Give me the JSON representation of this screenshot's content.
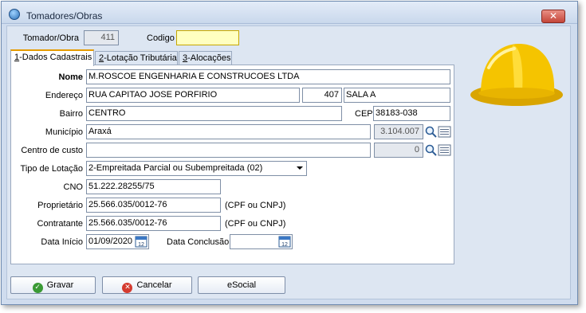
{
  "window": {
    "title": "Tomadores/Obras",
    "close_label": "✕"
  },
  "header": {
    "tomador_label": "Tomador/Obra",
    "tomador_value": "411",
    "codigo_label": "Codigo",
    "codigo_value": ""
  },
  "tabs": [
    {
      "key": "1",
      "label": "-Dados Cadastrais",
      "active": true
    },
    {
      "key": "2",
      "label": "-Lotação Tributária",
      "active": false
    },
    {
      "key": "3",
      "label": "-Alocações",
      "active": false
    }
  ],
  "form": {
    "nome_label": "Nome",
    "nome_value": "M.ROSCOE ENGENHARIA E CONSTRUCOES LTDA",
    "endereco_label": "Endereço",
    "endereco_value": "RUA CAPITAO JOSE PORFIRIO",
    "numero_value": "407",
    "complemento_value": "SALA A",
    "bairro_label": "Bairro",
    "bairro_value": "CENTRO",
    "cep_label": "CEP",
    "cep_value": "38183-038",
    "municipio_label": "Município",
    "municipio_value": "Araxá",
    "municipio_code": "3.104.007",
    "centro_custo_label": "Centro de custo",
    "centro_custo_value": "",
    "centro_custo_code": "0",
    "tipo_lotacao_label": "Tipo de Lotação",
    "tipo_lotacao_value": "2-Empreitada Parcial ou Subempreitada (02)",
    "cno_label": "CNO",
    "cno_value": "51.222.28255/75",
    "proprietario_label": "Proprietário",
    "proprietario_value": "25.566.035/0012-76",
    "proprietario_hint": "(CPF ou CNPJ)",
    "contratante_label": "Contratante",
    "contratante_value": "25.566.035/0012-76",
    "contratante_hint": "(CPF ou CNPJ)",
    "data_inicio_label": "Data Início",
    "data_inicio_value": "01/09/2020",
    "data_conclusao_label": "Data Conclusão",
    "data_conclusao_value": "",
    "calendar_day": "12"
  },
  "buttons": {
    "gravar": "Gravar",
    "cancelar": "Cancelar",
    "esocial": "eSocial"
  },
  "colors": {
    "accent_tab": "#e59b00",
    "readonly_field": "#e4e8ee",
    "highlight_field": "#ffffc0",
    "helmet": "#f5c400"
  }
}
